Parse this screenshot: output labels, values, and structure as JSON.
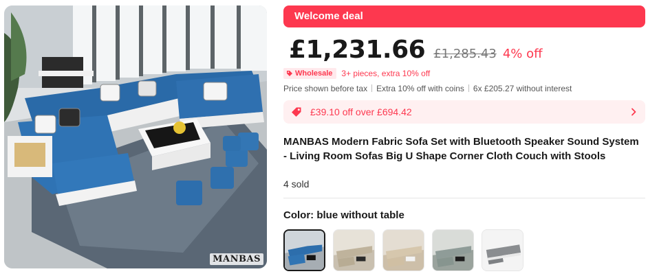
{
  "gallery": {
    "brand_watermark": "MANBAS",
    "main_image_icon": "corner-sofa-photo"
  },
  "deal": {
    "banner_label": "Welcome deal"
  },
  "price": {
    "current": "£1,231.66",
    "original": "£1,285.43",
    "discount": "4% off"
  },
  "wholesale": {
    "tag_label": "Wholesale",
    "offer_text": "3+ pieces, extra 10% off"
  },
  "sub_info": {
    "tax_note": "Price shown before tax",
    "coins_note": "Extra 10% off with coins",
    "installment_note": "6x £205.27 without interest"
  },
  "coupon": {
    "text": "£39.10 off over £694.42",
    "icon": "price-tag-icon"
  },
  "product": {
    "title": "MANBAS Modern Fabric Sofa Set with Bluetooth Speaker Sound System - Living Room Sofas Big U Shape Corner Cloth Couch with Stools",
    "sold": "4 sold"
  },
  "color_selector": {
    "label": "Color: blue without table",
    "selected_index": 0,
    "options": [
      "blue without table",
      "option 2",
      "option 3",
      "option 4",
      "option 5"
    ]
  },
  "colors": {
    "accent": "#fd384f",
    "accent_light": "#fff0f1",
    "text": "#191919"
  }
}
